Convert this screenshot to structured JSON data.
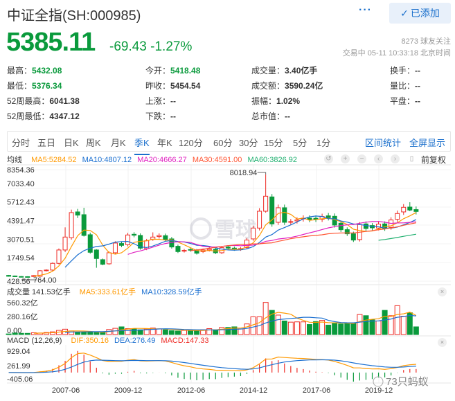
{
  "header": {
    "title": "中证全指(SH:000985)",
    "more_label": "···",
    "added_label": "已添加",
    "price": "5385.11",
    "change": "-69.43",
    "change_pct": "-1.27%",
    "followers": "8273 球友关注",
    "status_time": "交易中 05-11 10:33:18 北京时间"
  },
  "stats": [
    [
      {
        "k": "最高：",
        "v": "5432.08",
        "c": "g"
      },
      {
        "k": "今开：",
        "v": "5418.48",
        "c": "g"
      },
      {
        "k": "成交量：",
        "v": "3.40亿手"
      },
      {
        "k": "换手：",
        "v": "--"
      }
    ],
    [
      {
        "k": "最低：",
        "v": "5376.34",
        "c": "g"
      },
      {
        "k": "昨收：",
        "v": "5454.54"
      },
      {
        "k": "成交额：",
        "v": "3590.24亿"
      },
      {
        "k": "量比：",
        "v": "--"
      }
    ],
    [
      {
        "k": "52周最高：",
        "v": "6041.38"
      },
      {
        "k": "上涨：",
        "v": "--"
      },
      {
        "k": "振幅：",
        "v": "1.02%"
      },
      {
        "k": "平盘：",
        "v": "--"
      }
    ],
    [
      {
        "k": "52周最低：",
        "v": "4347.12"
      },
      {
        "k": "下跌：",
        "v": "--"
      },
      {
        "k": "总市值：",
        "v": "--"
      }
    ]
  ],
  "tabs": [
    "分时",
    "五日",
    "日K",
    "周K",
    "月K",
    "季K",
    "年K",
    "120分",
    "60分",
    "30分",
    "15分",
    "5分",
    "1分"
  ],
  "active_tab": "季K",
  "tab_links": [
    "区间统计",
    "全屏显示"
  ],
  "ma_legend": {
    "label": "均线",
    "ma5": "MA5:5284.52",
    "ma10": "MA10:4807.12",
    "ma20": "MA20:4666.27",
    "ma30": "MA30:4591.00",
    "ma60": "MA60:3826.92"
  },
  "toolbar": {
    "adjust_label": "前复权"
  },
  "colors": {
    "up": "#ee2a24",
    "down": "#0a9a3c",
    "ma5": "#ff9900",
    "ma10": "#1a6fd0",
    "ma20": "#e020c0",
    "ma30": "#ff5533",
    "ma60": "#20b070",
    "accent": "#1a6fcc"
  },
  "volume_legend": {
    "label": "成交量 141.53亿手",
    "ma5": "MA5:333.61亿手",
    "ma10": "MA10:328.59亿手"
  },
  "macd_legend": {
    "label": "MACD (12,26,9)",
    "dif": "DIF:350.16",
    "dea": "DEA:276.49",
    "macd": "MACD:147.33"
  },
  "watermark": {
    "brand": "雪球",
    "credit": "73只蚂蚁"
  },
  "chart_data": {
    "type": "candlestick",
    "period": "quarterly",
    "price_ticks": [
      "8354.36",
      "7033.40",
      "5712.43",
      "4391.47",
      "3070.51",
      "1749.54",
      "428.56"
    ],
    "price_range": [
      428.56,
      8354.36
    ],
    "max_label": "8018.94",
    "min_label": "764.00",
    "volume_ticks": [
      "560.32亿",
      "280.16亿",
      "0.00"
    ],
    "macd_ticks": [
      "929.04",
      "261.99",
      "-405.06"
    ],
    "x_ticks": [
      "2007-06",
      "2009-12",
      "2012-06",
      "2014-12",
      "2017-06",
      "2019-12"
    ],
    "candles": [
      [
        840,
        780
      ],
      [
        800,
        770
      ],
      [
        760,
        750
      ],
      [
        750,
        745
      ],
      [
        760,
        830
      ],
      [
        777,
        1171
      ],
      [
        1171,
        1220
      ],
      [
        1220,
        1696
      ],
      [
        1696,
        2647
      ],
      [
        2647,
        3565,
        4254,
        2500
      ],
      [
        3520,
        5304
      ],
      [
        5353,
        5124
      ],
      [
        5156,
        3680,
        5648,
        3600
      ],
      [
        3730,
        2483
      ],
      [
        2647,
        2040,
        2700,
        1384
      ],
      [
        1958,
        1630
      ],
      [
        1663,
        2450
      ],
      [
        2450,
        3139
      ],
      [
        3106,
        2975
      ],
      [
        3024,
        3713
      ],
      [
        3762,
        3696
      ],
      [
        3680,
        2778
      ],
      [
        2745,
        3303
      ],
      [
        3401,
        3565,
        3900,
        3300
      ],
      [
        3598,
        3680
      ],
      [
        3663,
        3401
      ],
      [
        3434,
        2860
      ],
      [
        2909,
        2532
      ],
      [
        2565,
        2614
      ],
      [
        2680,
        2630
      ],
      [
        2614,
        2417
      ],
      [
        2532,
        2647
      ],
      [
        2647,
        2729
      ],
      [
        2696,
        2450
      ],
      [
        2450,
        2811
      ],
      [
        2860,
        2778
      ],
      [
        2778,
        2696
      ],
      [
        2696,
        2745
      ],
      [
        2811,
        3352
      ],
      [
        3434,
        4205
      ],
      [
        4205,
        5402
      ],
      [
        5402,
        6468,
        8018.94,
        5300
      ],
      [
        6419,
        4500,
        6620,
        4300
      ],
      [
        4615,
        5648
      ],
      [
        5648,
        4615
      ],
      [
        4615,
        4664
      ],
      [
        4713,
        4779
      ],
      [
        4861,
        4910
      ],
      [
        4910,
        4812
      ],
      [
        4900,
        4830
      ],
      [
        4828,
        5025
      ],
      [
        5074,
        4943
      ],
      [
        5041,
        4418
      ],
      [
        4549,
        4090
      ],
      [
        4090,
        3795
      ],
      [
        3795,
        3352
      ],
      [
        3385,
        4451
      ],
      [
        4500,
        4172
      ],
      [
        4385,
        4221
      ],
      [
        4205,
        4484
      ],
      [
        4500,
        4172
      ],
      [
        4254,
        4779
      ],
      [
        4828,
        5238
      ],
      [
        5353,
        5681
      ],
      [
        5697,
        5484,
        6041,
        5400
      ],
      [
        5517,
        5385
      ]
    ],
    "volumes": [
      10,
      25,
      20,
      20,
      30,
      25,
      35,
      45,
      70,
      90,
      60,
      36,
      40,
      40,
      38,
      42,
      85,
      105,
      130,
      100,
      100,
      80,
      95,
      110,
      95,
      80,
      65,
      60,
      70,
      70,
      70,
      80,
      100,
      80,
      120,
      120,
      130,
      95,
      180,
      300,
      300,
      545,
      410,
      330,
      230,
      210,
      215,
      215,
      170,
      220,
      240,
      160,
      200,
      180,
      185,
      200,
      340,
      320,
      250,
      230,
      410,
      320,
      490,
      310,
      370,
      130
    ],
    "volume_range": [
      0,
      600
    ],
    "macd_range": [
      -405.06,
      929.04
    ]
  }
}
